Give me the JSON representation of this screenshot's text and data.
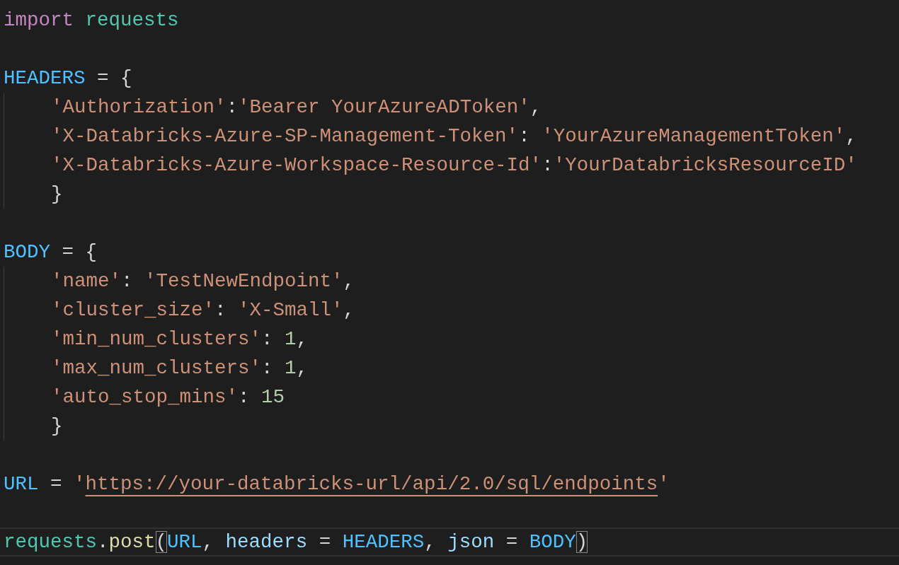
{
  "editor": {
    "lines": [
      {
        "current": false,
        "tokens": [
          {
            "text": "import ",
            "kind": "keyword"
          },
          {
            "text": "requests",
            "kind": "module"
          }
        ]
      },
      {
        "current": false
      },
      {
        "current": false,
        "tokens": [
          {
            "text": "HEADERS",
            "kind": "constant"
          },
          {
            "text": " = {",
            "kind": "plain"
          }
        ]
      },
      {
        "current": false,
        "tokens": [
          {
            "text": "    'Authorization'",
            "kind": "string"
          },
          {
            "text": ":",
            "kind": "plain"
          },
          {
            "text": "'Bearer YourAzureADToken'",
            "kind": "string"
          },
          {
            "text": ",",
            "kind": "plain"
          }
        ]
      },
      {
        "current": false,
        "tokens": [
          {
            "text": "    'X-Databricks-Azure-SP-Management-Token'",
            "kind": "string"
          },
          {
            "text": ": ",
            "kind": "plain"
          },
          {
            "text": "'YourAzureManagementToken'",
            "kind": "string"
          },
          {
            "text": ",",
            "kind": "plain"
          }
        ]
      },
      {
        "current": false,
        "tokens": [
          {
            "text": "    'X-Databricks-Azure-Workspace-Resource-Id'",
            "kind": "string"
          },
          {
            "text": ":",
            "kind": "plain"
          },
          {
            "text": "'YourDatabricksResourceID'",
            "kind": "string"
          }
        ]
      },
      {
        "current": false,
        "tokens": [
          {
            "text": "    }",
            "kind": "plain"
          }
        ]
      },
      {
        "current": false
      },
      {
        "current": false,
        "tokens": [
          {
            "text": "BODY",
            "kind": "constant"
          },
          {
            "text": " = {",
            "kind": "plain"
          }
        ]
      },
      {
        "current": false,
        "tokens": [
          {
            "text": "    'name'",
            "kind": "string"
          },
          {
            "text": ": ",
            "kind": "plain"
          },
          {
            "text": "'TestNewEndpoint'",
            "kind": "string"
          },
          {
            "text": ",",
            "kind": "plain"
          }
        ]
      },
      {
        "current": false,
        "tokens": [
          {
            "text": "    'cluster_size'",
            "kind": "string"
          },
          {
            "text": ": ",
            "kind": "plain"
          },
          {
            "text": "'X-Small'",
            "kind": "string"
          },
          {
            "text": ",",
            "kind": "plain"
          }
        ]
      },
      {
        "current": false,
        "tokens": [
          {
            "text": "    'min_num_clusters'",
            "kind": "string"
          },
          {
            "text": ": ",
            "kind": "plain"
          },
          {
            "text": "1",
            "kind": "number"
          },
          {
            "text": ",",
            "kind": "plain"
          }
        ]
      },
      {
        "current": false,
        "tokens": [
          {
            "text": "    'max_num_clusters'",
            "kind": "string"
          },
          {
            "text": ": ",
            "kind": "plain"
          },
          {
            "text": "1",
            "kind": "number"
          },
          {
            "text": ",",
            "kind": "plain"
          }
        ]
      },
      {
        "current": false,
        "tokens": [
          {
            "text": "    'auto_stop_mins'",
            "kind": "string"
          },
          {
            "text": ": ",
            "kind": "plain"
          },
          {
            "text": "15",
            "kind": "number"
          }
        ]
      },
      {
        "current": false,
        "tokens": [
          {
            "text": "    }",
            "kind": "plain"
          }
        ]
      },
      {
        "current": false
      },
      {
        "current": false,
        "tokens": [
          {
            "text": "URL",
            "kind": "constant"
          },
          {
            "text": " = ",
            "kind": "plain"
          },
          {
            "text": "'",
            "kind": "string"
          },
          {
            "text": "https://your-databricks-url/api/2.0/sql/endpoints",
            "kind": "string",
            "link": true
          },
          {
            "text": "'",
            "kind": "string"
          }
        ]
      },
      {
        "current": false
      },
      {
        "current": true,
        "tokens": [
          {
            "text": "requests",
            "kind": "module"
          },
          {
            "text": ".",
            "kind": "plain"
          },
          {
            "text": "post",
            "kind": "function"
          },
          {
            "text": "(",
            "kind": "plain",
            "matched": true
          },
          {
            "text": "URL",
            "kind": "constant"
          },
          {
            "text": ", ",
            "kind": "plain"
          },
          {
            "text": "headers",
            "kind": "variable"
          },
          {
            "text": " = ",
            "kind": "plain"
          },
          {
            "text": "HEADERS",
            "kind": "constant"
          },
          {
            "text": ", ",
            "kind": "plain"
          },
          {
            "text": "json",
            "kind": "variable"
          },
          {
            "text": " = ",
            "kind": "plain"
          },
          {
            "text": "BODY",
            "kind": "constant"
          },
          {
            "text": ")",
            "kind": "plain",
            "matched": true
          }
        ]
      }
    ]
  }
}
